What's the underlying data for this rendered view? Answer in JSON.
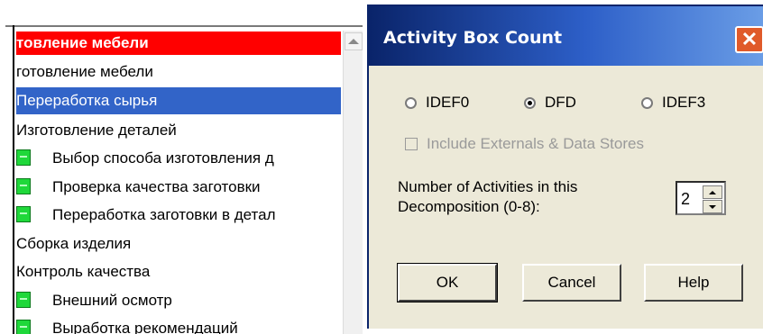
{
  "tree": {
    "header": "товление мебели",
    "items": [
      {
        "label": "готовление мебели"
      },
      {
        "label": "Переработка сырья"
      },
      {
        "label": "Изготовление деталей"
      },
      {
        "label": "Выбор  способа изготовления д"
      },
      {
        "label": "Проверка  качества заготовки"
      },
      {
        "label": "Переработка заготовки в детал"
      },
      {
        "label": "Сборка изделия"
      },
      {
        "label": "Контроль качества"
      },
      {
        "label": "Внешний осмотр"
      },
      {
        "label": "Выработка  рекомендаций"
      }
    ]
  },
  "dialog": {
    "title": "Activity Box Count",
    "close": "✕",
    "radios": [
      {
        "label": "IDEF0",
        "checked": false
      },
      {
        "label": "DFD",
        "checked": true
      },
      {
        "label": "IDEF3",
        "checked": false
      }
    ],
    "checkbox_label": "Include Externals & Data Stores",
    "activities_label": "Number of Activities in this Decomposition (0-8):",
    "spinner_value": "2",
    "buttons": {
      "ok": "OK",
      "cancel": "Cancel",
      "help": "Help"
    }
  }
}
